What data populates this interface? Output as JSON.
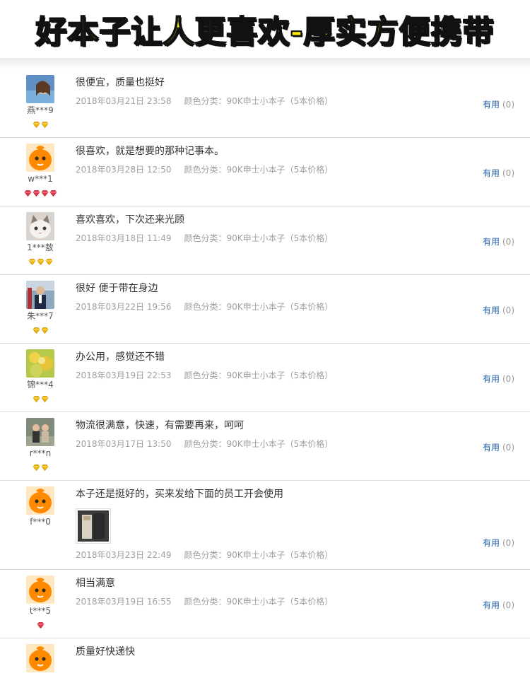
{
  "banner": {
    "title": "好本子让人更喜欢-厚实方便携带"
  },
  "reviews": [
    {
      "user": "燕***9",
      "avatar": "photo-avatar-woman",
      "badges": {
        "type": "gold",
        "count": 2
      },
      "comment": "很便宜，质量也挺好",
      "date": "2018年03月21日 23:58",
      "sku": "颜色分类：90K申士小本子（5本价格）",
      "useful_label": "有用",
      "useful_count": "(0)"
    },
    {
      "user": "w***1",
      "avatar": "taobao-default-avatar",
      "badges": {
        "type": "red",
        "count": 4
      },
      "comment": "很喜欢，就是想要的那种记事本。",
      "date": "2018年03月28日 12:50",
      "sku": "颜色分类：90K申士小本子（5本价格）",
      "useful_label": "有用",
      "useful_count": "(0)"
    },
    {
      "user": "1***敖",
      "avatar": "photo-avatar-cat",
      "badges": {
        "type": "gold",
        "count": 3
      },
      "comment": "喜欢喜欢，下次还来光顾",
      "date": "2018年03月18日 11:49",
      "sku": "颜色分类：90K申士小本子（5本价格）",
      "useful_label": "有用",
      "useful_count": "(0)"
    },
    {
      "user": "朱***7",
      "avatar": "photo-avatar-man",
      "badges": {
        "type": "gold",
        "count": 2
      },
      "comment": "很好 便于带在身边",
      "date": "2018年03月22日 19:56",
      "sku": "颜色分类：90K申士小本子（5本价格）",
      "useful_label": "有用",
      "useful_count": "(0)"
    },
    {
      "user": "锦***4",
      "avatar": "photo-avatar-flowers",
      "badges": {
        "type": "gold",
        "count": 2
      },
      "comment": "办公用，感觉还不错",
      "date": "2018年03月19日 22:53",
      "sku": "颜色分类：90K申士小本子（5本价格）",
      "useful_label": "有用",
      "useful_count": "(0)"
    },
    {
      "user": "r***n",
      "avatar": "photo-avatar-couple",
      "badges": {
        "type": "gold",
        "count": 2
      },
      "comment": "物流很满意，快速，有需要再来，呵呵",
      "date": "2018年03月17日 13:50",
      "sku": "颜色分类：90K申士小本子（5本价格）",
      "useful_label": "有用",
      "useful_count": "(0)"
    },
    {
      "user": "f***0",
      "avatar": "taobao-default-avatar",
      "badges": {
        "type": "none",
        "count": 0
      },
      "comment": "本子还是挺好的，买来发给下面的员工开会使用",
      "has_photo": true,
      "date": "2018年03月23日 22:49",
      "sku": "颜色分类：90K申士小本子（5本价格）",
      "useful_label": "有用",
      "useful_count": "(0)"
    },
    {
      "user": "t***5",
      "avatar": "taobao-default-avatar",
      "badges": {
        "type": "red",
        "count": 1
      },
      "comment": "相当满意",
      "date": "2018年03月19日 16:55",
      "sku": "颜色分类：90K申士小本子（5本价格）",
      "useful_label": "有用",
      "useful_count": "(0)"
    },
    {
      "user": "",
      "avatar": "taobao-default-avatar",
      "badges": {
        "type": "none",
        "count": 0
      },
      "comment": "质量好快递快",
      "date": "",
      "sku": "",
      "useful_label": "",
      "useful_count": ""
    }
  ],
  "colors": {
    "banner_fill": "#ffee00",
    "banner_stroke": "#111111",
    "useful_link": "#1f5fa6",
    "meta_gray": "#a0a0a0",
    "gold_badge": "#f2b705",
    "red_badge": "#e8334a",
    "default_avatar": "#ff8a00"
  }
}
